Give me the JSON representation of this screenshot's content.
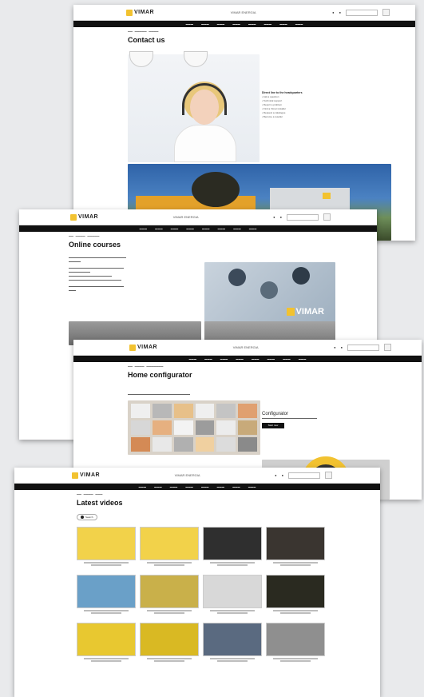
{
  "brand": "VIMAR",
  "cards": {
    "contact": {
      "title": "Contact us",
      "tagline": "VIMAR ENERGIA",
      "info_heading": "Direct line to the headquarters",
      "info_lines": [
        "•  Ask a question",
        "•  Technical support",
        "•  Report a problem",
        "•  Find a Vimar installer",
        "•  Request a catalogue",
        "•  Become a reseller"
      ]
    },
    "courses": {
      "title": "Online courses",
      "tagline": "VIMAR ENERGIA",
      "overlay_brand": "VIMAR"
    },
    "configurator": {
      "title": "Home configurator",
      "tagline": "VIMAR ENERGIA",
      "side_title": "Configurator",
      "side_button": "Start now"
    },
    "videos": {
      "title": "Latest videos",
      "tagline": "VIMAR ENERGIA",
      "filter": "Search"
    }
  },
  "video_colors": [
    "#f2d24a",
    "#f2d24a",
    "#2f2f2f",
    "#3a3530",
    "#6aa0c8",
    "#c9b04a",
    "#d8d8d8",
    "#2a2a20",
    "#e8c830",
    "#d9b923",
    "#5a6a80",
    "#8f8f8f"
  ]
}
